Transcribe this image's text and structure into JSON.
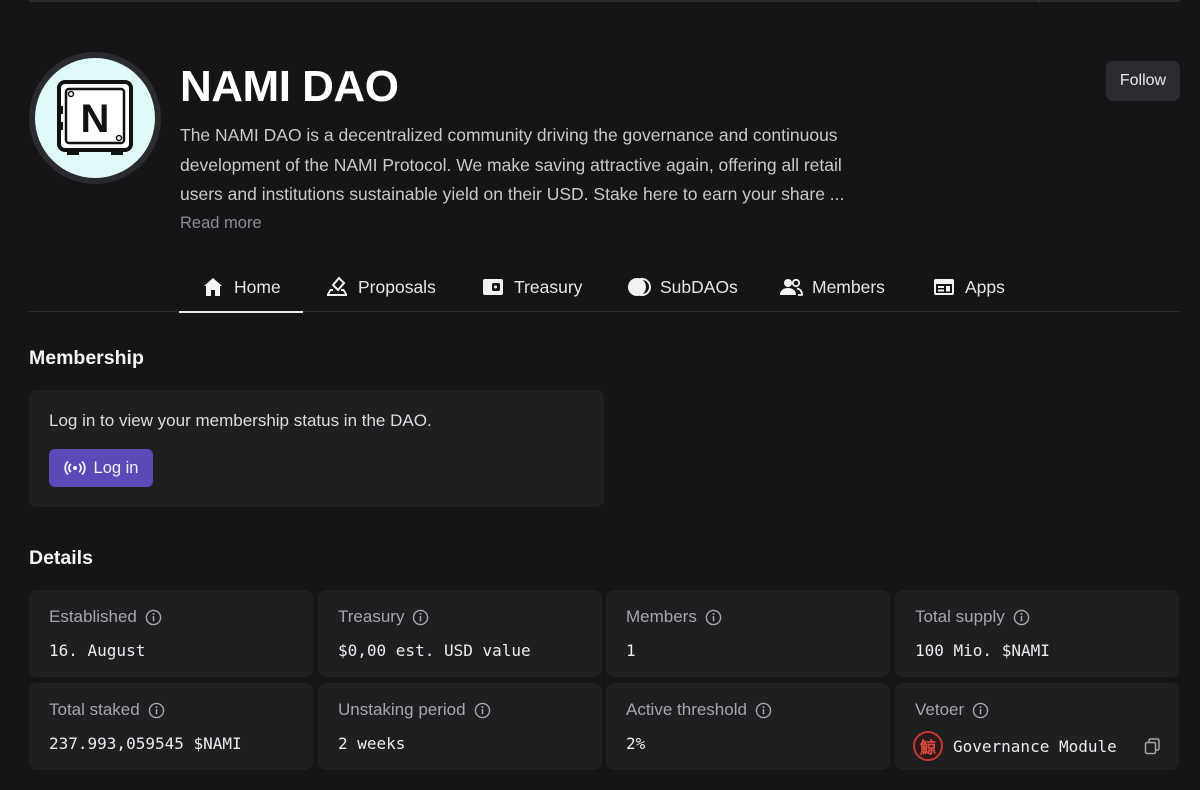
{
  "dao": {
    "name": "NAMI DAO",
    "description": "The NAMI DAO is a decentralized community driving the governance and continuous development of the NAMI Protocol. We make saving attractive again, offering all retail users and institutions sustainable yield on their USD. Stake here to earn your share ...",
    "read_more": "Read more",
    "follow_label": "Follow",
    "logo_letter": "N"
  },
  "tabs": [
    {
      "label": "Home",
      "icon": "home-icon",
      "active": true
    },
    {
      "label": "Proposals",
      "icon": "ballot-icon"
    },
    {
      "label": "Treasury",
      "icon": "wallet-icon"
    },
    {
      "label": "SubDAOs",
      "icon": "circles-icon"
    },
    {
      "label": "Members",
      "icon": "users-icon"
    },
    {
      "label": "Apps",
      "icon": "apps-icon"
    }
  ],
  "membership": {
    "title": "Membership",
    "message": "Log in to view your membership status in the DAO.",
    "login_label": "Log in"
  },
  "details": {
    "title": "Details",
    "items": [
      {
        "label": "Established",
        "value": "16. August"
      },
      {
        "label": "Treasury",
        "value": "$0,00 est. USD value"
      },
      {
        "label": "Members",
        "value": "1"
      },
      {
        "label": "Total supply",
        "value": "100 Mio. $NAMI"
      },
      {
        "label": "Total staked",
        "value": "237.993,059545 $NAMI"
      },
      {
        "label": "Unstaking period",
        "value": "2 weeks"
      },
      {
        "label": "Active threshold",
        "value": "2%"
      },
      {
        "label": "Vetoer",
        "value": "Governance Module"
      }
    ],
    "vetoer_seal": "鯨"
  },
  "colors": {
    "background": "#151517",
    "card": "#1e1f21",
    "accent": "#5b49b8",
    "logo_bg": "#dff9fb"
  }
}
